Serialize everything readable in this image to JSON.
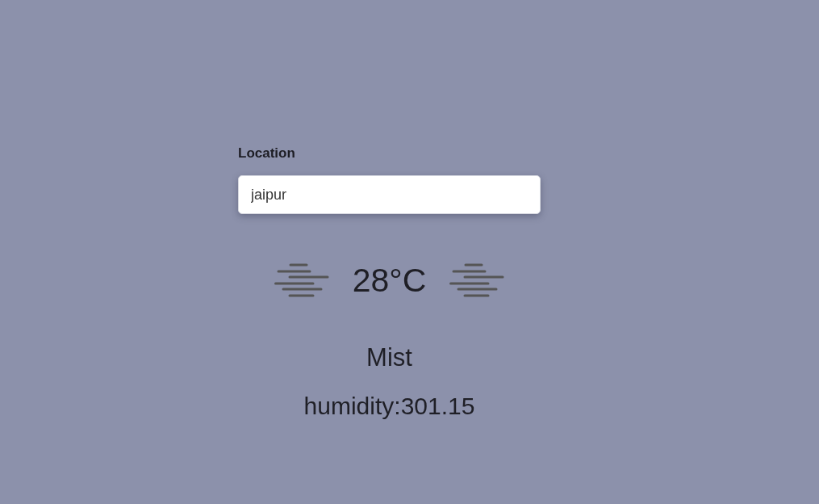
{
  "location": {
    "label": "Location",
    "value": "jaipur"
  },
  "weather": {
    "temperature": "28°C",
    "condition": "Mist",
    "humidity": "humidity:301.15"
  }
}
